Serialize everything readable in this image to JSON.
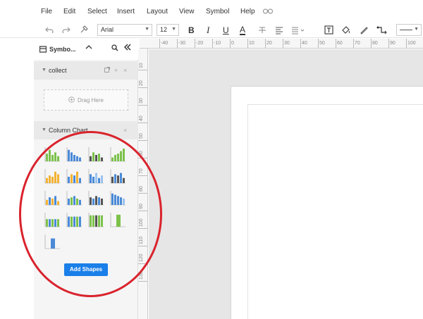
{
  "menu": {
    "items": [
      "File",
      "Edit",
      "Select",
      "Insert",
      "Layout",
      "View",
      "Symbol",
      "Help"
    ]
  },
  "toolbar": {
    "font": "Arial",
    "size": "12",
    "bold": "B",
    "italic": "I",
    "underline": "U",
    "font_color": "A"
  },
  "panel": {
    "title": "Symbo...",
    "collect": {
      "label": "collect",
      "drop_text": "Drag Here"
    },
    "library": {
      "label": "Column Chart"
    },
    "add_shapes": "Add Shapes"
  },
  "ruler": {
    "top": [
      "-40",
      "-30",
      "-20",
      "-10",
      "0",
      "10",
      "20",
      "30",
      "40",
      "50",
      "60",
      "70",
      "80",
      "90",
      "100"
    ],
    "left": [
      "10",
      "20",
      "30",
      "40",
      "50",
      "60",
      "70",
      "80",
      "90",
      "100",
      "110",
      "120",
      "130"
    ]
  },
  "colors": {
    "accent": "#1a7fe8",
    "highlight": "#d9232d",
    "canvas": "#e6e6e6"
  }
}
